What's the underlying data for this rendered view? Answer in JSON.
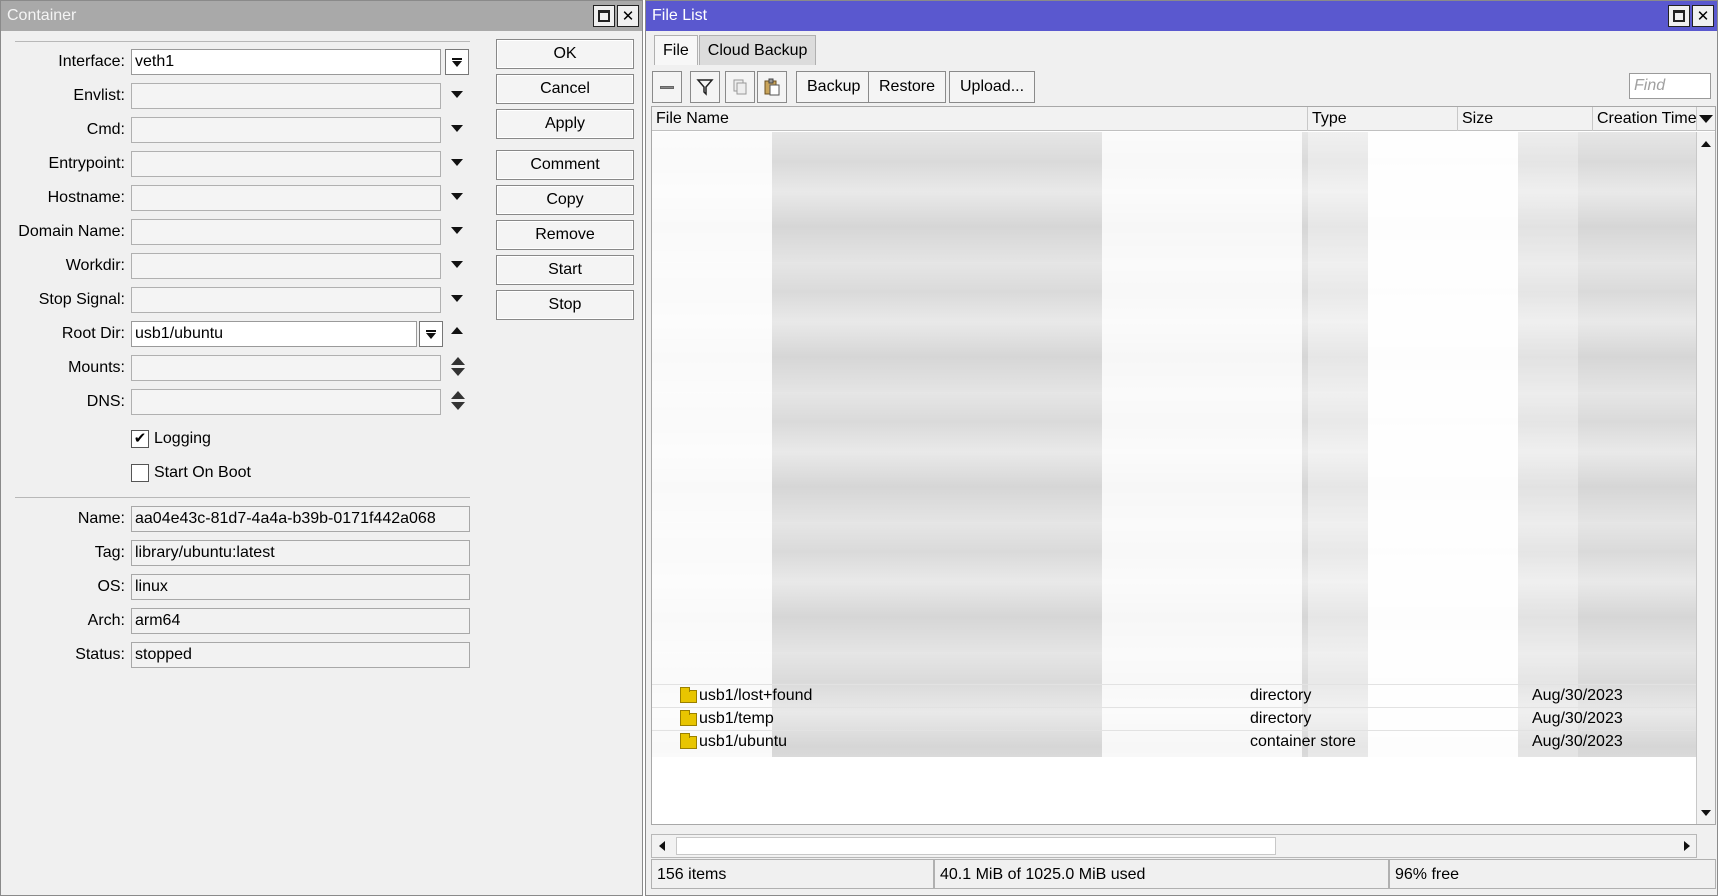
{
  "container": {
    "title": "Container",
    "fields": {
      "interface": {
        "label": "Interface:",
        "value": "veth1"
      },
      "envlist": {
        "label": "Envlist:",
        "value": ""
      },
      "cmd": {
        "label": "Cmd:",
        "value": ""
      },
      "entrypoint": {
        "label": "Entrypoint:",
        "value": ""
      },
      "hostname": {
        "label": "Hostname:",
        "value": ""
      },
      "domain_name": {
        "label": "Domain Name:",
        "value": ""
      },
      "workdir": {
        "label": "Workdir:",
        "value": ""
      },
      "stop_signal": {
        "label": "Stop Signal:",
        "value": ""
      },
      "root_dir": {
        "label": "Root Dir:",
        "value": "usb1/ubuntu"
      },
      "mounts": {
        "label": "Mounts:",
        "value": ""
      },
      "dns": {
        "label": "DNS:",
        "value": ""
      }
    },
    "logging": {
      "label": "Logging",
      "checked": true,
      "mark": "✔"
    },
    "start_on_boot": {
      "label": "Start On Boot",
      "checked": false
    },
    "info": {
      "name": {
        "label": "Name:",
        "value": "aa04e43c-81d7-4a4a-b39b-0171f442a068"
      },
      "tag": {
        "label": "Tag:",
        "value": "library/ubuntu:latest"
      },
      "os": {
        "label": "OS:",
        "value": "linux"
      },
      "arch": {
        "label": "Arch:",
        "value": "arm64"
      },
      "status": {
        "label": "Status:",
        "value": "stopped"
      }
    },
    "buttons": {
      "ok": "OK",
      "cancel": "Cancel",
      "apply": "Apply",
      "comment": "Comment",
      "copy": "Copy",
      "remove": "Remove",
      "start": "Start",
      "stop": "Stop"
    }
  },
  "file_list": {
    "title": "File List",
    "tabs": {
      "file": "File",
      "cloud_backup": "Cloud Backup"
    },
    "toolbar": {
      "backup": "Backup",
      "restore": "Restore",
      "upload": "Upload...",
      "find_placeholder": "Find"
    },
    "columns": {
      "file_name": "File Name",
      "type": "Type",
      "size": "Size",
      "creation_time": "Creation Time"
    },
    "rows": [
      {
        "name": "usb1/lost+found",
        "type": "directory",
        "size": "",
        "created": "Aug/30/2023"
      },
      {
        "name": "usb1/temp",
        "type": "directory",
        "size": "",
        "created": "Aug/30/2023"
      },
      {
        "name": "usb1/ubuntu",
        "type": "container store",
        "size": "",
        "created": "Aug/30/2023"
      }
    ],
    "status": {
      "items": "156 items",
      "used": "40.1 MiB of 1025.0 MiB used",
      "free": "96% free"
    }
  },
  "colors": {
    "filelist_titlebar": "#5a58cf",
    "container_titlebar": "#a9a9a9",
    "folder": "#e8c500"
  }
}
